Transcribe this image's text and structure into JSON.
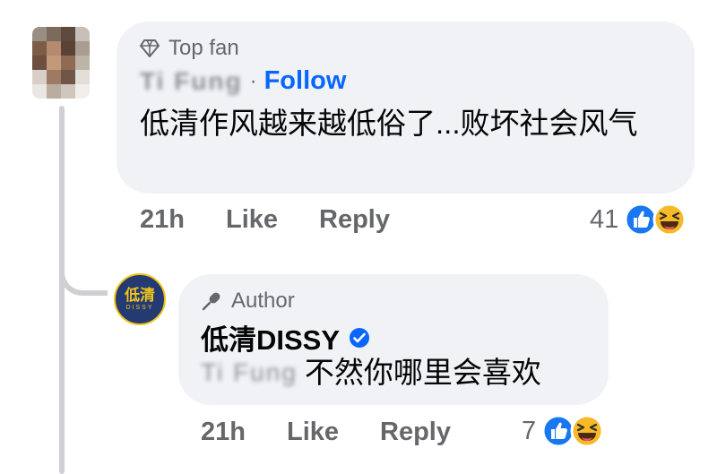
{
  "comment": {
    "badge": "Top fan",
    "author_name": "Ti Fung",
    "separator": "·",
    "follow_label": "Follow",
    "text": "低清作风越来越低俗了...败坏社会风气",
    "time": "21h",
    "like_label": "Like",
    "reply_label": "Reply",
    "reaction_count": "41",
    "reactions": [
      "like-icon",
      "haha-icon"
    ]
  },
  "reply": {
    "badge": "Author",
    "page_avatar_text": "低清",
    "page_avatar_subtext": "DISSY",
    "author_name": "低清DISSY",
    "verified": true,
    "mention": "Ti Fung",
    "text": "不然你哪里会喜欢",
    "time": "21h",
    "like_label": "Like",
    "reply_label": "Reply",
    "reaction_count": "7",
    "reactions": [
      "like-icon",
      "haha-icon"
    ]
  },
  "colors": {
    "bubble": "#f0f2f5",
    "link_blue": "#0866ff",
    "secondary_text": "#65676b",
    "reaction_yellow": "#f7b928"
  }
}
